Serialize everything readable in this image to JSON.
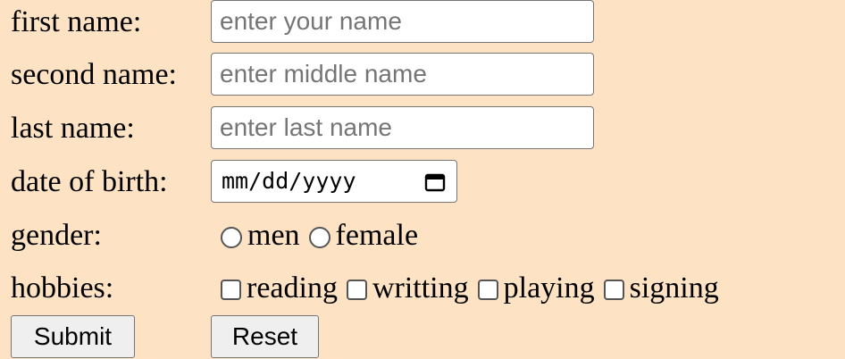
{
  "form": {
    "first_name": {
      "label": "first name:",
      "value": "",
      "placeholder": "enter your name"
    },
    "second_name": {
      "label": "second name:",
      "value": "",
      "placeholder": "enter middle name"
    },
    "last_name": {
      "label": "last name:",
      "value": "",
      "placeholder": "enter last name"
    },
    "date_of_birth": {
      "label": "date of birth:",
      "display": "mm/dd/yyyy",
      "icon": "calendar-icon"
    },
    "gender": {
      "label": "gender:",
      "options": [
        {
          "label": "men",
          "selected": false
        },
        {
          "label": "female",
          "selected": false
        }
      ]
    },
    "hobbies": {
      "label": "hobbies:",
      "options": [
        {
          "label": "reading",
          "checked": false
        },
        {
          "label": "writting",
          "checked": false
        },
        {
          "label": "playing",
          "checked": false
        },
        {
          "label": "signing",
          "checked": false
        }
      ]
    },
    "submit_label": "Submit",
    "reset_label": "Reset"
  },
  "colors": {
    "background": "#fde2c4",
    "input_border": "#767676",
    "button_bg": "#efefef"
  }
}
